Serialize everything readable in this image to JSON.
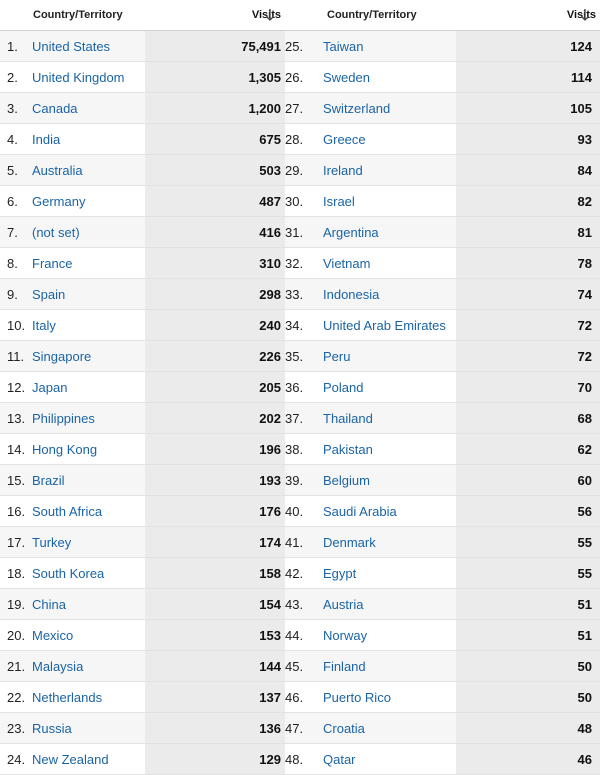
{
  "table": {
    "left_header": {
      "country": "Country/Territory",
      "visits": "Visits"
    },
    "right_header": {
      "country": "Country/Territory",
      "visits": "Visits"
    },
    "sort_icon": "arrow-down-icon",
    "left_rows": [
      {
        "rank": "1.",
        "country": "United States",
        "visits": "75,491"
      },
      {
        "rank": "2.",
        "country": "United Kingdom",
        "visits": "1,305"
      },
      {
        "rank": "3.",
        "country": "Canada",
        "visits": "1,200"
      },
      {
        "rank": "4.",
        "country": "India",
        "visits": "675"
      },
      {
        "rank": "5.",
        "country": "Australia",
        "visits": "503"
      },
      {
        "rank": "6.",
        "country": "Germany",
        "visits": "487"
      },
      {
        "rank": "7.",
        "country": "(not set)",
        "visits": "416"
      },
      {
        "rank": "8.",
        "country": "France",
        "visits": "310"
      },
      {
        "rank": "9.",
        "country": "Spain",
        "visits": "298"
      },
      {
        "rank": "10.",
        "country": "Italy",
        "visits": "240"
      },
      {
        "rank": "11.",
        "country": "Singapore",
        "visits": "226"
      },
      {
        "rank": "12.",
        "country": "Japan",
        "visits": "205"
      },
      {
        "rank": "13.",
        "country": "Philippines",
        "visits": "202"
      },
      {
        "rank": "14.",
        "country": "Hong Kong",
        "visits": "196"
      },
      {
        "rank": "15.",
        "country": "Brazil",
        "visits": "193"
      },
      {
        "rank": "16.",
        "country": "South Africa",
        "visits": "176"
      },
      {
        "rank": "17.",
        "country": "Turkey",
        "visits": "174"
      },
      {
        "rank": "18.",
        "country": "South Korea",
        "visits": "158"
      },
      {
        "rank": "19.",
        "country": "China",
        "visits": "154"
      },
      {
        "rank": "20.",
        "country": "Mexico",
        "visits": "153"
      },
      {
        "rank": "21.",
        "country": "Malaysia",
        "visits": "144"
      },
      {
        "rank": "22.",
        "country": "Netherlands",
        "visits": "137"
      },
      {
        "rank": "23.",
        "country": "Russia",
        "visits": "136"
      },
      {
        "rank": "24.",
        "country": "New Zealand",
        "visits": "129"
      }
    ],
    "right_rows": [
      {
        "rank": "25.",
        "country": "Taiwan",
        "visits": "124"
      },
      {
        "rank": "26.",
        "country": "Sweden",
        "visits": "114"
      },
      {
        "rank": "27.",
        "country": "Switzerland",
        "visits": "105"
      },
      {
        "rank": "28.",
        "country": "Greece",
        "visits": "93"
      },
      {
        "rank": "29.",
        "country": "Ireland",
        "visits": "84"
      },
      {
        "rank": "30.",
        "country": "Israel",
        "visits": "82"
      },
      {
        "rank": "31.",
        "country": "Argentina",
        "visits": "81"
      },
      {
        "rank": "32.",
        "country": "Vietnam",
        "visits": "78"
      },
      {
        "rank": "33.",
        "country": "Indonesia",
        "visits": "74"
      },
      {
        "rank": "34.",
        "country": "United Arab Emirates",
        "visits": "72"
      },
      {
        "rank": "35.",
        "country": "Peru",
        "visits": "72"
      },
      {
        "rank": "36.",
        "country": "Poland",
        "visits": "70"
      },
      {
        "rank": "37.",
        "country": "Thailand",
        "visits": "68"
      },
      {
        "rank": "38.",
        "country": "Pakistan",
        "visits": "62"
      },
      {
        "rank": "39.",
        "country": "Belgium",
        "visits": "60"
      },
      {
        "rank": "40.",
        "country": "Saudi Arabia",
        "visits": "56"
      },
      {
        "rank": "41.",
        "country": "Denmark",
        "visits": "55"
      },
      {
        "rank": "42.",
        "country": "Egypt",
        "visits": "55"
      },
      {
        "rank": "43.",
        "country": "Austria",
        "visits": "51"
      },
      {
        "rank": "44.",
        "country": "Norway",
        "visits": "51"
      },
      {
        "rank": "45.",
        "country": "Finland",
        "visits": "50"
      },
      {
        "rank": "46.",
        "country": "Puerto Rico",
        "visits": "50"
      },
      {
        "rank": "47.",
        "country": "Croatia",
        "visits": "48"
      },
      {
        "rank": "48.",
        "country": "Qatar",
        "visits": "46"
      }
    ],
    "colors": {
      "link": "#1a64a6",
      "row_alt": "#f6f6f6",
      "visits_shade": "#ebebeb"
    }
  }
}
